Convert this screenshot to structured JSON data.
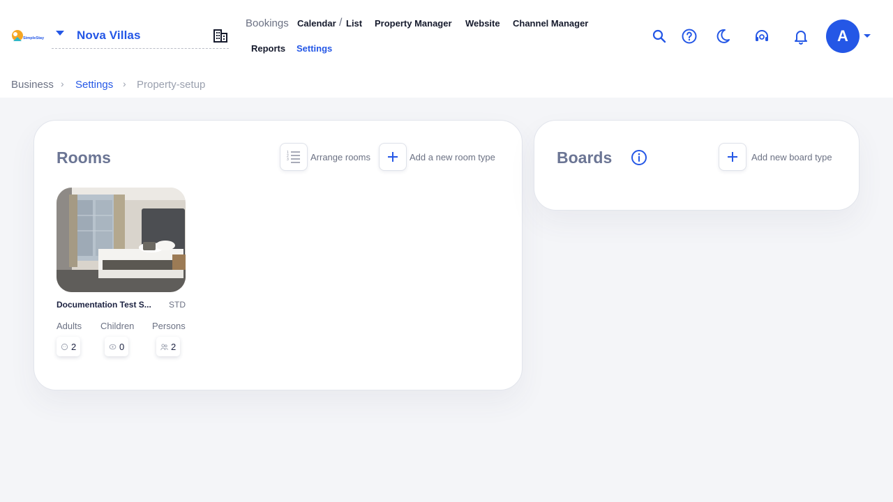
{
  "app": {
    "logo_text": "SimpleStay",
    "property_name": "Nova Villas"
  },
  "nav": {
    "bookings": "Bookings",
    "calendar": "Calendar",
    "slash": "/",
    "list": "List",
    "property_manager": "Property Manager",
    "website": "Website",
    "channel_manager": "Channel Manager",
    "reports": "Reports",
    "settings": "Settings"
  },
  "user": {
    "initial": "A"
  },
  "icons": [
    "chevron-down-icon",
    "building-icon",
    "search-icon",
    "help-icon",
    "moon-icon",
    "headset-icon",
    "bell-icon",
    "arrange-list-icon",
    "plus-icon",
    "info-icon",
    "baby-icon",
    "child-icon",
    "persons-icon"
  ],
  "breadcrumb": {
    "items": [
      "Business",
      "Settings",
      "Property-setup"
    ],
    "separator": "›"
  },
  "rooms": {
    "title": "Rooms",
    "arrange_label": "Arrange rooms",
    "add_label": "Add a new room type",
    "items": [
      {
        "name": "Documentation Test S...",
        "code": "STD",
        "adults_label": "Adults",
        "children_label": "Children",
        "persons_label": "Persons",
        "adults": "2",
        "children": "0",
        "persons": "2"
      }
    ]
  },
  "boards": {
    "title": "Boards",
    "add_label": "Add new board type"
  },
  "colors": {
    "accent": "#2457e6",
    "background": "#f4f5f8",
    "title_gray": "#6b7594"
  }
}
